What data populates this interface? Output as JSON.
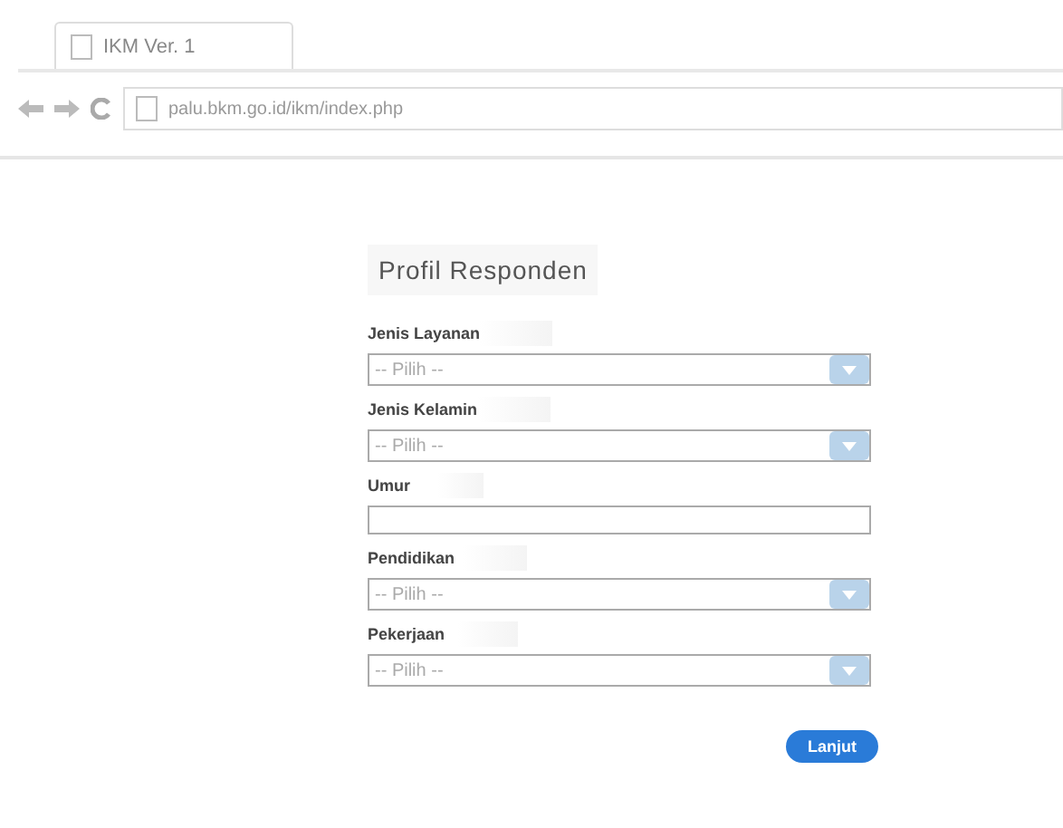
{
  "browser": {
    "tab_title": "IKM Ver. 1",
    "url": "palu.bkm.go.id/ikm/index.php"
  },
  "form": {
    "title": "Profil Responden",
    "fields": [
      {
        "kind": "select",
        "label": "Jenis Layanan",
        "placeholder": "-- Pilih --"
      },
      {
        "kind": "select",
        "label": "Jenis Kelamin",
        "placeholder": "-- Pilih --"
      },
      {
        "kind": "text",
        "label": "Umur"
      },
      {
        "kind": "select",
        "label": "Pendidikan",
        "placeholder": "-- Pilih --"
      },
      {
        "kind": "select",
        "label": "Pekerjaan",
        "placeholder": "-- Pilih --"
      }
    ],
    "submit": "Lanjut"
  }
}
